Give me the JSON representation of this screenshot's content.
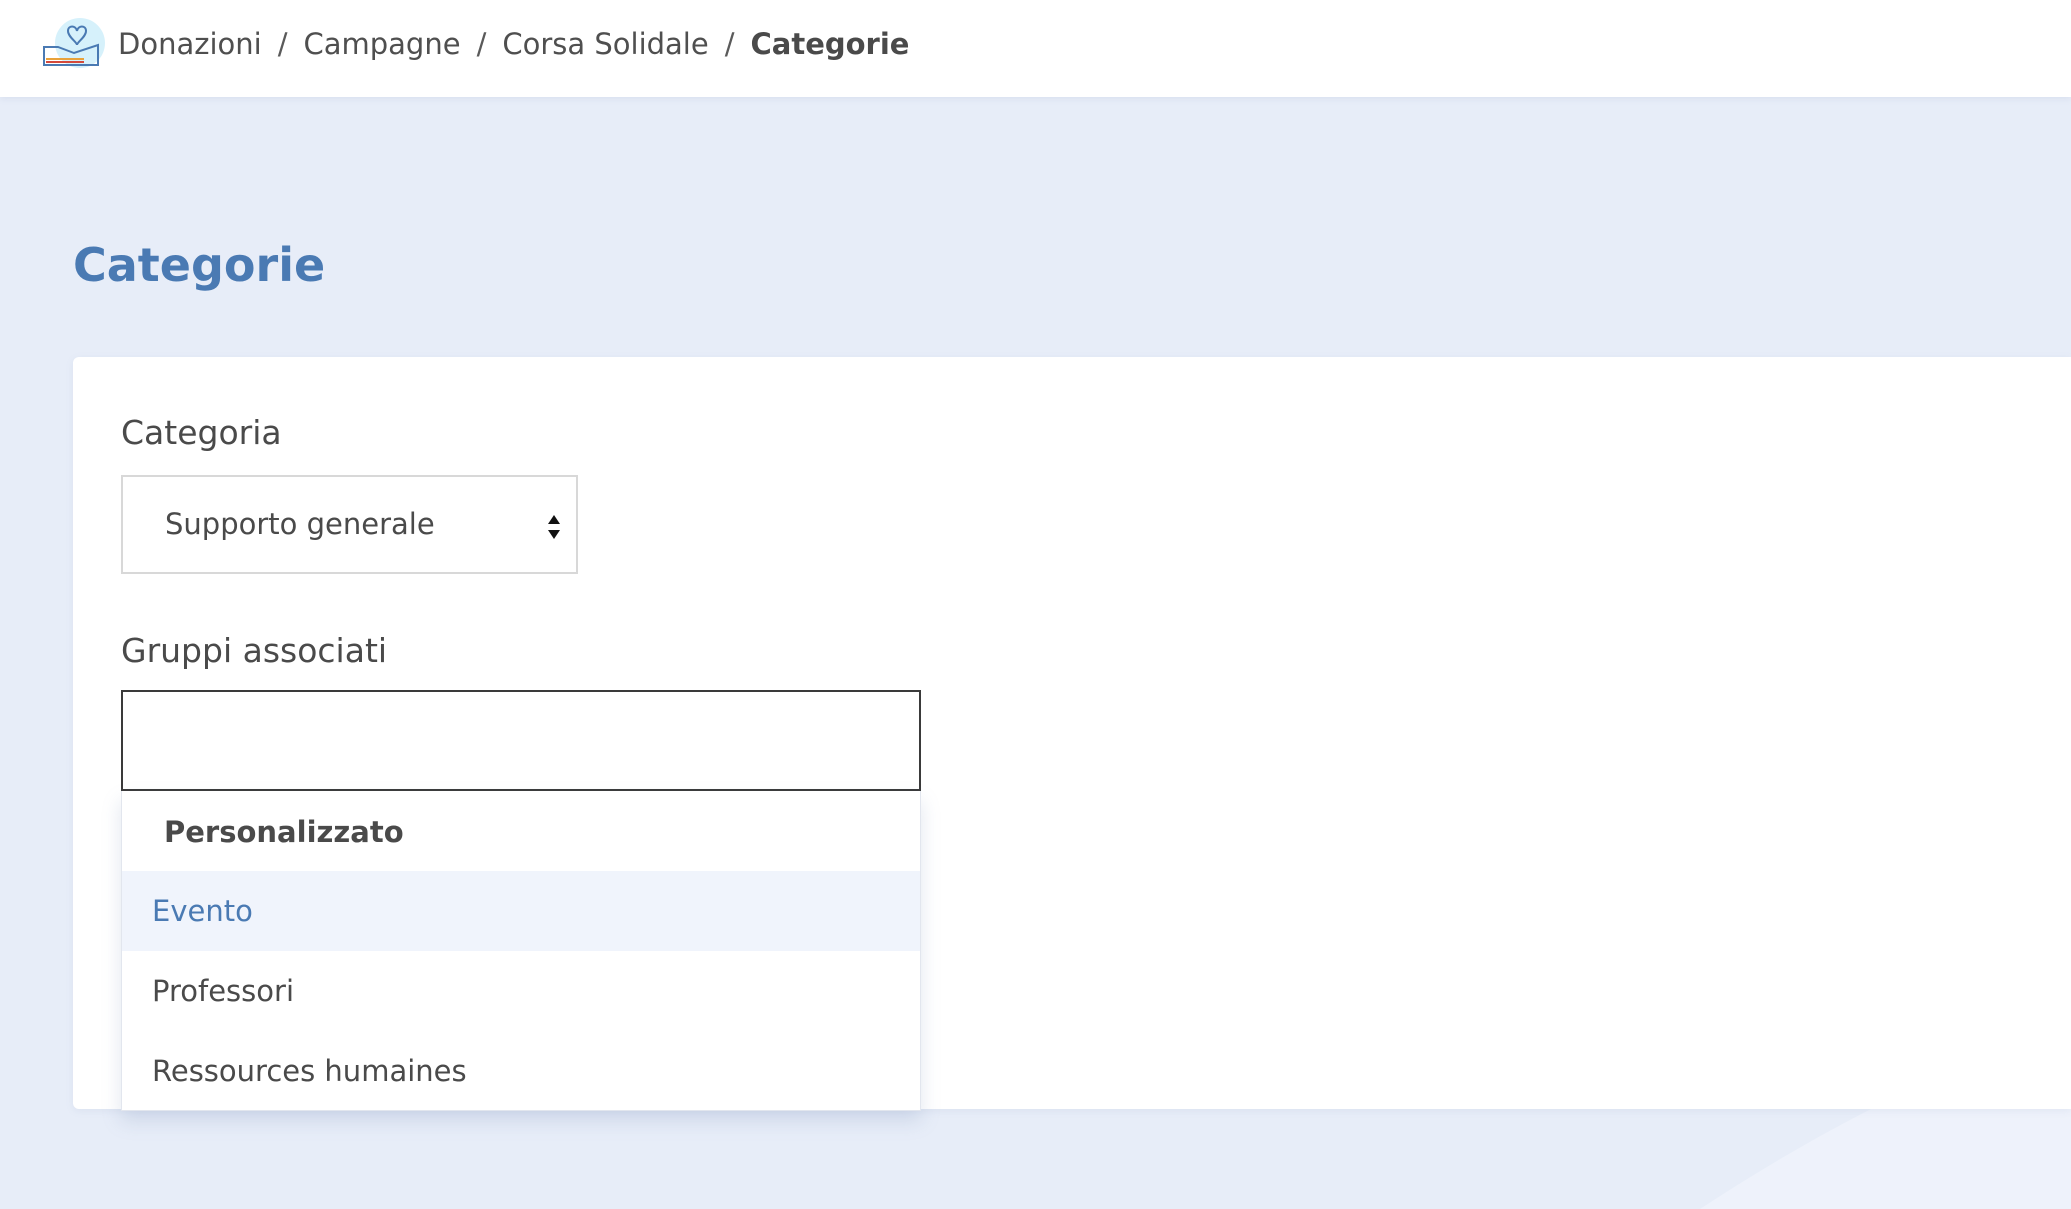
{
  "header": {
    "logo_icon": "donation-heart-hand-icon",
    "breadcrumb": [
      "Donazioni",
      "Campagne",
      "Corsa Solidale",
      "Categorie"
    ],
    "separator": "/"
  },
  "page": {
    "title": "Categorie"
  },
  "form": {
    "category": {
      "label": "Categoria",
      "selected_value": "Supporto generale",
      "arrow_icon": "select-arrows-icon"
    },
    "groups": {
      "label": "Gruppi associati",
      "search_value": "",
      "dropdown": {
        "group_header": "Personalizzato",
        "options": [
          "Evento",
          "Professori",
          "Ressources humaines"
        ],
        "highlighted": "Evento"
      }
    }
  },
  "colors": {
    "accent": "#4a7ab3",
    "background": "#e7edf8",
    "highlight": "#f0f4fc",
    "text": "#4a4a4a"
  }
}
